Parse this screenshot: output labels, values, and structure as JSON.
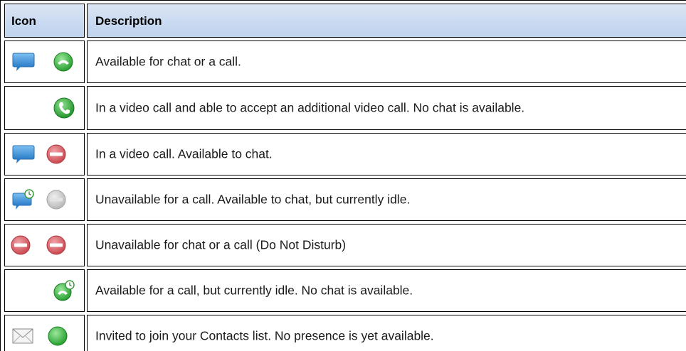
{
  "table": {
    "header": {
      "icon": "Icon",
      "description": "Description"
    },
    "rows": [
      {
        "icons": [
          "chat-bubble-icon",
          "phone-available-icon"
        ],
        "description": "Available for chat or a call."
      },
      {
        "icons": [
          "",
          "phone-in-call-icon"
        ],
        "description": "In a video call and able to accept an additional video call.  No chat is available."
      },
      {
        "icons": [
          "chat-bubble-icon",
          "do-not-disturb-icon"
        ],
        "description": "In a video call. Available to chat."
      },
      {
        "icons": [
          "chat-bubble-idle-icon",
          "unavailable-grey-icon"
        ],
        "description": "Unavailable for a call. Available to chat, but currently idle."
      },
      {
        "icons": [
          "do-not-disturb-icon",
          "do-not-disturb-icon"
        ],
        "description": "Unavailable for chat or a call (Do Not Disturb)"
      },
      {
        "icons": [
          "",
          "phone-idle-icon"
        ],
        "description": "Available for a call, but currently idle. No chat is available."
      },
      {
        "icons": [
          "envelope-icon",
          "green-dot-icon"
        ],
        "description": "Invited to join your Contacts list. No presence is yet available."
      }
    ]
  },
  "colors": {
    "header_bg": "#c8d9f0",
    "border": "#000000",
    "green": "#2fae2f",
    "red": "#d9535b",
    "blue": "#3a8fd6",
    "grey": "#c8c8c8"
  }
}
